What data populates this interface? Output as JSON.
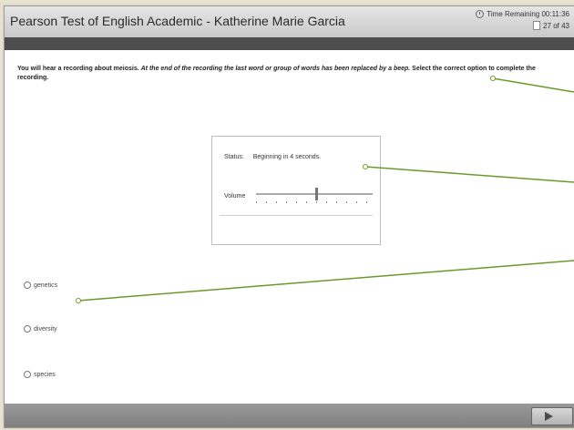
{
  "header": {
    "title": "Pearson Test of English Academic - Katherine Marie Garcia",
    "timer": "Time Remaining 00:11:36",
    "counter": "27 of 43"
  },
  "instructions": {
    "part1": "You will hear a recording about meiosis. ",
    "part2": "At the end of the recording the last word or group of words has been replaced by a beep.",
    "part3": " Select the correct option to complete the recording."
  },
  "audio": {
    "status_label": "Status:",
    "status_value": "Beginning in 4 seconds.",
    "volume_label": "Volume",
    "volume_level": 0.52
  },
  "options": [
    {
      "label": "genetics"
    },
    {
      "label": "diversity"
    },
    {
      "label": "species"
    }
  ],
  "colors": {
    "annotation_line": "#6b9a2a",
    "title_bar": "#d6d6d6",
    "sub_bar": "#4d4d4d",
    "background": "#e6e2cf"
  }
}
